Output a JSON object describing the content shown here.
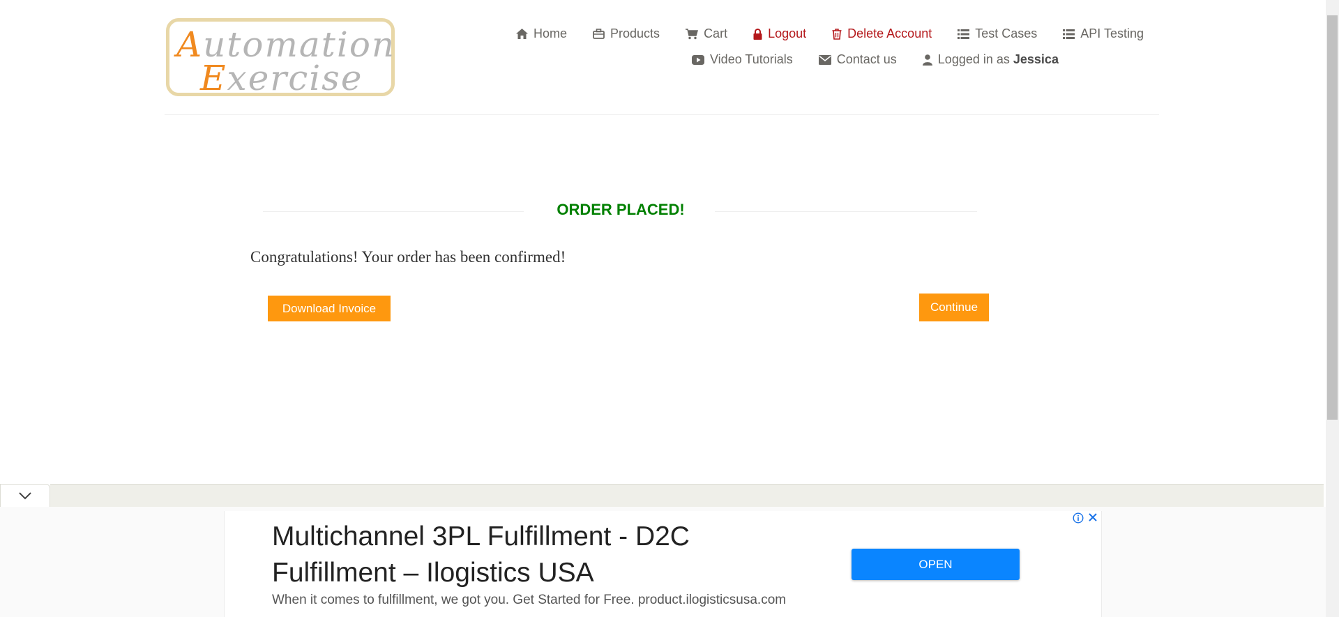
{
  "logo": {
    "line1_cap": "A",
    "line1_rest": "utomation",
    "line2_cap": "E",
    "line2_rest": "xercise"
  },
  "nav": {
    "home": "Home",
    "products": "Products",
    "cart": "Cart",
    "logout": "Logout",
    "delete_account": "Delete Account",
    "test_cases": "Test Cases",
    "api_testing": "API Testing",
    "video_tutorials": "Video Tutorials",
    "contact_us": "Contact us",
    "logged_in_prefix": "Logged in as",
    "username": "Jessica"
  },
  "main": {
    "title": "ORDER PLACED!",
    "message": "Congratulations! Your order has been confirmed!",
    "download_invoice": "Download Invoice",
    "continue": "Continue"
  },
  "ad": {
    "headline": "Multichannel 3PL Fulfillment - D2C Fulfillment – Ilogistics USA",
    "description": "When it comes to fulfillment, we got you. Get Started for Free. product.ilogisticsusa.com",
    "cta": "OPEN"
  },
  "colors": {
    "accent_orange": "#FE980F",
    "success_green": "#008000",
    "danger_red": "#B4181B",
    "ad_blue": "#0A85FF"
  },
  "icons": [
    "home-icon",
    "briefcase-icon",
    "cart-icon",
    "lock-icon",
    "trash-icon",
    "list-icon",
    "youtube-play-icon",
    "envelope-icon",
    "user-icon",
    "chevron-down-icon",
    "info-icon",
    "close-icon"
  ]
}
